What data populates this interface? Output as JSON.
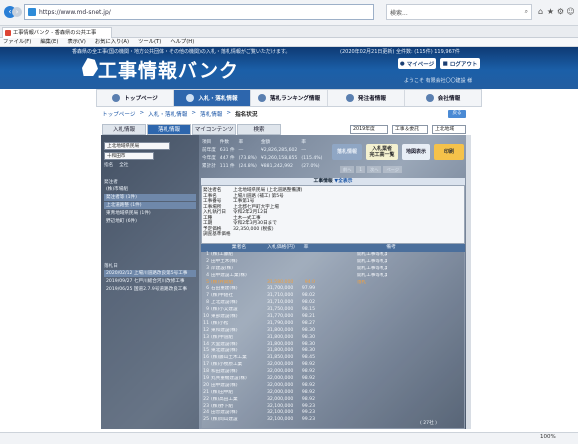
{
  "browser": {
    "url": "https://www.md-snet.jp/",
    "search_placeholder": "検索...",
    "tab_title": "工事情報バンク - 香森県の公共工事",
    "menu": [
      "ファイル(F)",
      "編集(E)",
      "表示(V)",
      "お気に入り(A)",
      "ツール(T)",
      "ヘルプ(H)"
    ],
    "zoom": "100%"
  },
  "header": {
    "info_text": "香森県の全工事(国の機関・地方公共団体・その他の機関)の入札・落札情報がご覧いただけます。",
    "date_text": "(2020年02月21日更新) 全件数: (115件) 119,967件",
    "logo": "工事情報バンク",
    "mypage_label": "マイページ",
    "logout_label": "ログアウト",
    "welcome_text": "ようこそ 有限会社〇〇建設 様"
  },
  "global_nav": [
    {
      "label": "トップページ",
      "active": false
    },
    {
      "label": "入札・落札情報",
      "active": true
    },
    {
      "label": "落札ランキング情報",
      "active": false
    },
    {
      "label": "発注者情報",
      "active": false
    },
    {
      "label": "会社情報",
      "active": false
    }
  ],
  "breadcrumb": [
    "トップページ",
    "入札・落札情報",
    "落札情報",
    "指名状況"
  ],
  "logout_small": "戻る",
  "sub_tabs": [
    "入札情報",
    "落札情報",
    "マイコンテンツ",
    "検索"
  ],
  "filters": {
    "year": "2019年度",
    "office": "工事＆委託",
    "area": "上北地域"
  },
  "left_panel": {
    "district": "上北地域県民局",
    "city": "十和田市",
    "radio": [
      "指名",
      "全社"
    ],
    "section1_label": "発注者",
    "section1_items": [
      {
        "label": "(株)市場組",
        "hl": false
      },
      {
        "label": "発注者等 (1件)",
        "hl": true
      },
      {
        "label": "上北道路整 (1件)",
        "hl": true
      },
      {
        "label": "東青地域県民局 (1件)",
        "hl": false
      },
      {
        "label": "野辺地町 (6件)",
        "hl": false
      }
    ],
    "section2_label": "落札日",
    "section2_items": [
      {
        "label": "2020/02/12  上場川道路改良第5号工事",
        "hl": true
      },
      {
        "label": "2019/09/27  七戸川総合河川改修工事",
        "hl": false
      },
      {
        "label": "2019/06/25  国道2.7.9号道路改良工事",
        "hl": false
      }
    ]
  },
  "stats": {
    "headers": [
      "項目",
      "件数",
      "率",
      "金額",
      "率"
    ],
    "rows": [
      [
        "前年度",
        "631 件",
        "―",
        "¥2,826,285,602",
        "―"
      ],
      [
        "今年度",
        "447 件",
        "(73.8%)",
        "¥3,260,158,855",
        "(115.4%)"
      ],
      [
        "累計計",
        "111 件",
        "(24.8%)",
        "¥881,242,992",
        "(27.0%)"
      ]
    ]
  },
  "action_buttons": [
    "落札情報",
    "入札業者\n完工高一覧",
    "地図表示",
    "印刷"
  ],
  "pager": [
    "前へ",
    "1",
    "次へ",
    "ページ"
  ],
  "info_panel": {
    "title": "工事情報",
    "title_link": "▼全表示",
    "rows": [
      [
        "発注者名",
        "上北地域県民局 (上北道路整備課)"
      ],
      [
        "工事名",
        "上場川道路 (補工) 第5号"
      ],
      [
        "工事番号",
        "工事第1号"
      ],
      [
        "工事場所",
        "上北郡七戸町大字上場"
      ],
      [
        "入札執行日",
        "令和2年2月12日"
      ],
      [
        "工種",
        "土木一式工事"
      ],
      [
        "工期",
        "令和2年3月30日まで"
      ],
      [
        "予定価格",
        "32,350,000 (税抜)"
      ],
      [
        "調査基準価格",
        ""
      ]
    ]
  },
  "grid": {
    "headers": [
      "",
      "業者名",
      "入札価格(円)",
      "率",
      "備考"
    ],
    "rows": [
      [
        "1",
        "(株)工藤組",
        "",
        "",
        "開札工事等札業"
      ],
      [
        "2",
        "田中土木(株)",
        "",
        "",
        "開札工事等札業"
      ],
      [
        "3",
        "岸建設(株)",
        "",
        "",
        "開札工事等札業"
      ],
      [
        "4",
        "田中建設工業(株)",
        "",
        "",
        "開札工事等札業"
      ],
      [
        "5",
        "(株)井関組",
        "31,580,000",
        "94.0",
        "落札"
      ],
      [
        "6",
        "石田重建(株)",
        "31,700,000",
        "97.99",
        ""
      ],
      [
        "7",
        "(株)中組社",
        "31,710,000",
        "98.02",
        ""
      ],
      [
        "8",
        "上北建設(株)",
        "31,710,000",
        "98.02",
        ""
      ],
      [
        "9",
        "(株)小又建設",
        "31,750,000",
        "98.15",
        ""
      ],
      [
        "10",
        "東部建設(株)",
        "31,770,000",
        "98.21",
        ""
      ],
      [
        "11",
        "(株)小松",
        "31,790,000",
        "98.27",
        ""
      ],
      [
        "12",
        "東和建設(株)",
        "31,800,000",
        "98.30",
        ""
      ],
      [
        "13",
        "(株)中道組",
        "31,800,000",
        "98.30",
        ""
      ],
      [
        "14",
        "大里建設(株)",
        "31,800,000",
        "98.30",
        ""
      ],
      [
        "15",
        "東北建設(株)",
        "31,800,000",
        "98.30",
        ""
      ],
      [
        "16",
        "(株)藤山土木工業",
        "31,850,000",
        "98.45",
        ""
      ],
      [
        "17",
        "(株)小牧原工業",
        "32,000,000",
        "98.92",
        ""
      ],
      [
        "18",
        "和田建設(株)",
        "32,000,000",
        "98.92",
        ""
      ],
      [
        "19",
        "丸共重機建設(株)",
        "32,000,000",
        "98.92",
        ""
      ],
      [
        "20",
        "田中建設(株)",
        "32,000,000",
        "98.92",
        ""
      ],
      [
        "21",
        "(株)田中組",
        "32,000,000",
        "98.92",
        ""
      ],
      [
        "22",
        "(株)高田工業",
        "32,000,000",
        "98.92",
        ""
      ],
      [
        "23",
        "(株)野下組",
        "32,100,000",
        "99.23",
        ""
      ],
      [
        "24",
        "田舎建設(株)",
        "32,100,000",
        "99.23",
        ""
      ],
      [
        "25",
        "(株)岡山建設",
        "32,100,000",
        "99.23",
        ""
      ]
    ],
    "footer": "( 27社 )"
  }
}
